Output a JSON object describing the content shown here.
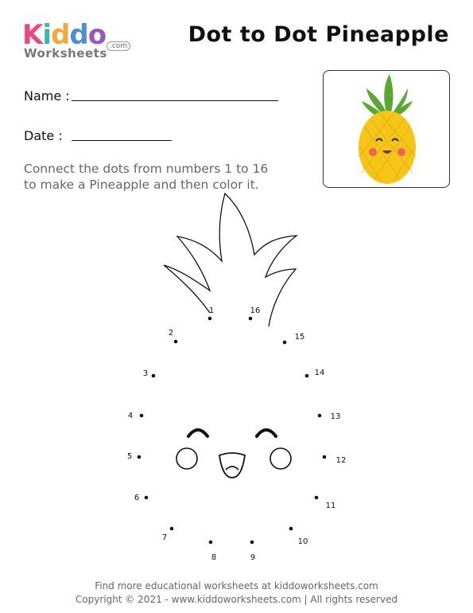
{
  "logo": {
    "letters": [
      "K",
      "i",
      "d",
      "d",
      "o"
    ],
    "letter_colors": [
      "#e84a7f",
      "#3bb5a8",
      "#f2a93b",
      "#4a90d9",
      "#9b59b6"
    ],
    "sub": "Worksheets",
    "dotcom": ".com"
  },
  "title": "Dot to Dot Pineapple",
  "form": {
    "name_label": "Name :",
    "date_label": "Date :"
  },
  "instructions": {
    "line1": "Connect the dots from numbers 1 to 16",
    "line2": "to make a Pineapple and then color it."
  },
  "dots": {
    "labels": [
      "1",
      "2",
      "3",
      "4",
      "5",
      "6",
      "7",
      "8",
      "9",
      "10",
      "11",
      "12",
      "13",
      "14",
      "15",
      "16"
    ]
  },
  "footer": {
    "line1": "Find more educational worksheets at kiddoworksheets.com",
    "line2": "Copyright © 2021 - www.kiddoworksheets.com  |  All rights reserved"
  },
  "colors": {
    "pineapple_body": "#f5c518",
    "pineapple_leaves": "#5aa832",
    "cheeks": "#f0605a"
  }
}
